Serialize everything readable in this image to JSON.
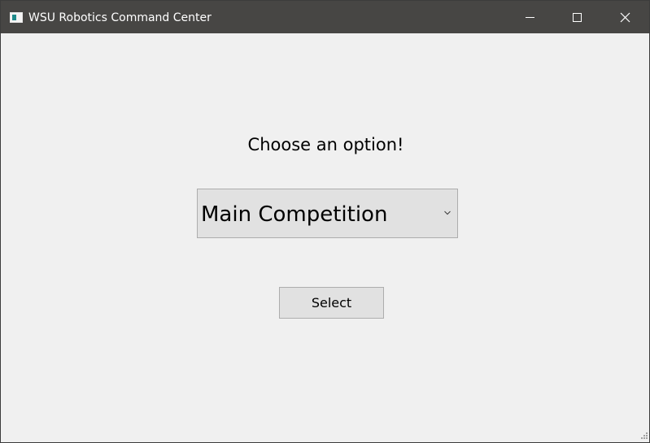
{
  "window": {
    "title": "WSU Robotics Command Center",
    "icons": {
      "app": "app-window-icon",
      "minimize": "minimize-icon",
      "maximize": "maximize-icon",
      "close": "close-icon",
      "dropdown": "chevron-down-icon",
      "resize": "size-grip-icon"
    }
  },
  "main": {
    "prompt": "Choose an option!",
    "dropdown": {
      "selected": "Main Competition"
    },
    "select_button_label": "Select"
  },
  "colors": {
    "titlebar": "#474644",
    "background": "#f0f0f0",
    "control_face": "#e1e1e1",
    "control_border": "#adadad"
  }
}
